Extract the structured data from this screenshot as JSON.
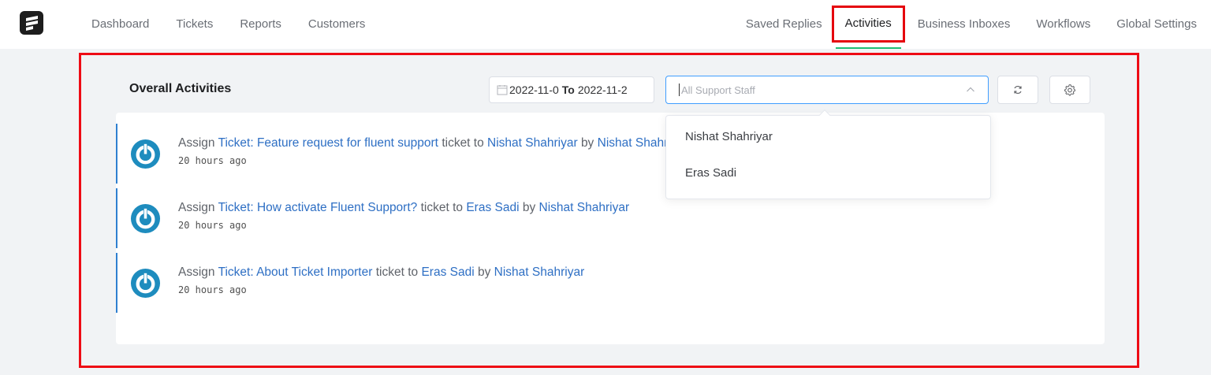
{
  "nav": {
    "left": [
      "Dashboard",
      "Tickets",
      "Reports",
      "Customers"
    ],
    "right_before": [
      "Saved Replies"
    ],
    "active": "Activities",
    "right_after": [
      "Business Inboxes",
      "Workflows",
      "Global Settings"
    ],
    "logo_icon": "fluent-support-logo-icon"
  },
  "page": {
    "title": "Overall Activities"
  },
  "filters": {
    "date_start": "2022-11-0",
    "date_separator": "To",
    "date_end": "2022-11-2",
    "staff_placeholder": "All Support Staff",
    "refresh_icon": "refresh-icon",
    "settings_icon": "gear-icon"
  },
  "dropdown": {
    "options": [
      "Nishat Shahriyar",
      "Eras Sadi"
    ]
  },
  "activities": [
    {
      "action": "Assign",
      "ticket": "Ticket: Feature request for fluent support",
      "mid": "ticket to",
      "assignee": "Nishat Shahriyar",
      "by": "by",
      "actor": "Nishat Shahriyar",
      "time": "20 hours ago"
    },
    {
      "action": "Assign",
      "ticket": "Ticket: How activate Fluent Support?",
      "mid": "ticket to",
      "assignee": "Eras Sadi",
      "by": "by",
      "actor": "Nishat Shahriyar",
      "time": "20 hours ago"
    },
    {
      "action": "Assign",
      "ticket": "Ticket: About Ticket Importer",
      "mid": "ticket to",
      "assignee": "Eras Sadi",
      "by": "by",
      "actor": "Nishat Shahriyar",
      "time": "20 hours ago"
    }
  ],
  "colors": {
    "accent": "#409eff",
    "link": "#2e6fc4",
    "highlight": "#ee0b14",
    "active_underline": "#1fbf75",
    "avatar": "#1e8cbe"
  }
}
